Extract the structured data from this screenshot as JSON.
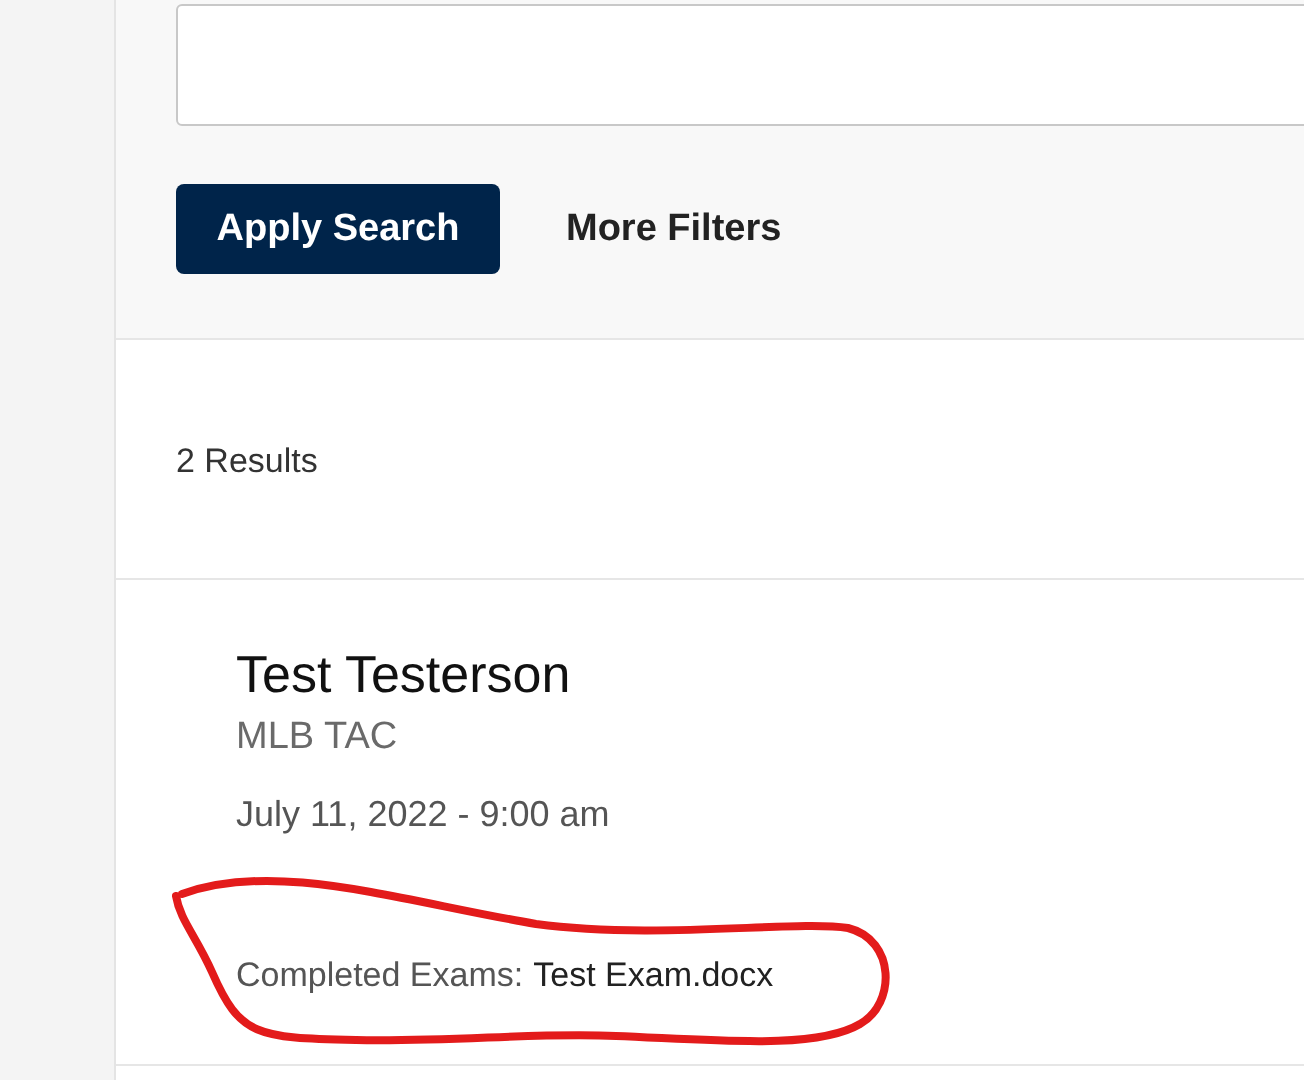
{
  "search_actions": [
    {
      "label": "Apply Search",
      "kind": "primary"
    },
    {
      "label": "More Filters",
      "kind": "link"
    }
  ],
  "results_count": "2 Results",
  "results": [
    {
      "name": "Test Testerson",
      "organization": "MLB TAC",
      "date": "July 11, 2022 - 9:00 am",
      "exams_label": "Completed Exams:",
      "exams_file": "Test Exam.docx",
      "circled": true
    }
  ]
}
